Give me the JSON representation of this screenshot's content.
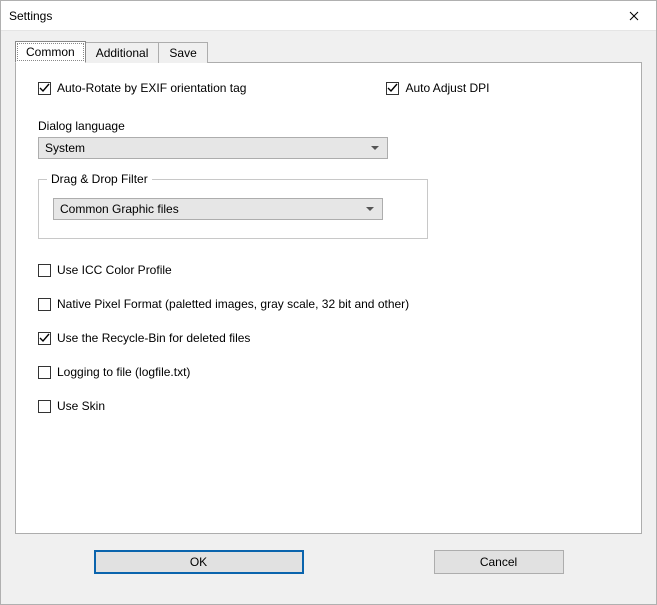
{
  "window": {
    "title": "Settings"
  },
  "tabs": {
    "0": {
      "label": "Common"
    },
    "1": {
      "label": "Additional"
    },
    "2": {
      "label": "Save"
    }
  },
  "common": {
    "autoRotate": {
      "label": "Auto-Rotate by EXIF orientation tag",
      "checked": true
    },
    "autoAdjustDPI": {
      "label": "Auto Adjust DPI",
      "checked": true
    },
    "dialogLanguage": {
      "label": "Dialog language",
      "value": "System"
    },
    "dragDropFilter": {
      "legend": "Drag & Drop Filter",
      "value": "Common Graphic files"
    },
    "useICC": {
      "label": "Use ICC Color Profile",
      "checked": false
    },
    "nativePixel": {
      "label": "Native Pixel Format (paletted images, gray scale, 32 bit and other)",
      "checked": false
    },
    "useRecycleBin": {
      "label": "Use the Recycle-Bin for deleted files",
      "checked": true
    },
    "loggingToFile": {
      "label": "Logging to file (logfile.txt)",
      "checked": false
    },
    "useSkin": {
      "label": "Use Skin",
      "checked": false
    }
  },
  "buttons": {
    "ok": "OK",
    "cancel": "Cancel"
  }
}
